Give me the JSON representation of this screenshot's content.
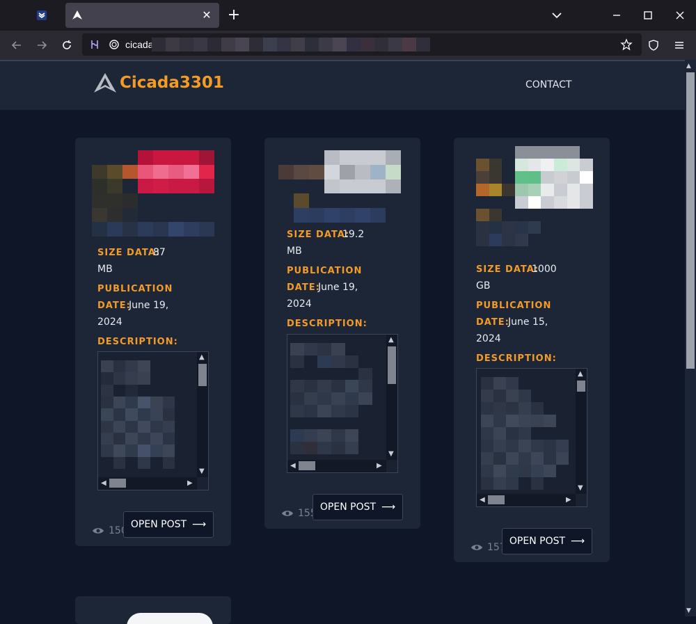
{
  "browser": {
    "tab_title": "",
    "tab_close": "✕",
    "new_tab": "+",
    "url_text": "cicadal",
    "window_controls": {
      "minimize": "—",
      "maximize": "☐",
      "close": "✕"
    },
    "icons": [
      "tab-list-icon",
      "back-icon",
      "forward-icon",
      "reload-icon",
      "extension-icon",
      "tracking-protection-icon",
      "bookmark-star-icon",
      "shield-icon",
      "menu-icon"
    ]
  },
  "site": {
    "logo_text": "Cicada3301",
    "nav_contact": "CONTACT",
    "brand_color": "#f29b26",
    "background": "#0f1628",
    "card_background": "#1d2637"
  },
  "labels": {
    "size": "SIZE DATA:",
    "publication": "PUBLICATION",
    "date": "DATE:",
    "description": "DESCRIPTION:",
    "open_post": "OPEN POST",
    "arrow": "⟶"
  },
  "posts": [
    {
      "size_value": "87",
      "size_unit": "MB",
      "date_value": "June 19,",
      "date_year": "2024",
      "views": "150"
    },
    {
      "size_value": "19.2",
      "size_unit": "MB",
      "date_value": "June 19,",
      "date_year": "2024",
      "views": "155"
    },
    {
      "size_value": "1000",
      "size_unit": "GB",
      "date_value": "June 15,",
      "date_year": "2024",
      "views": "157"
    }
  ]
}
